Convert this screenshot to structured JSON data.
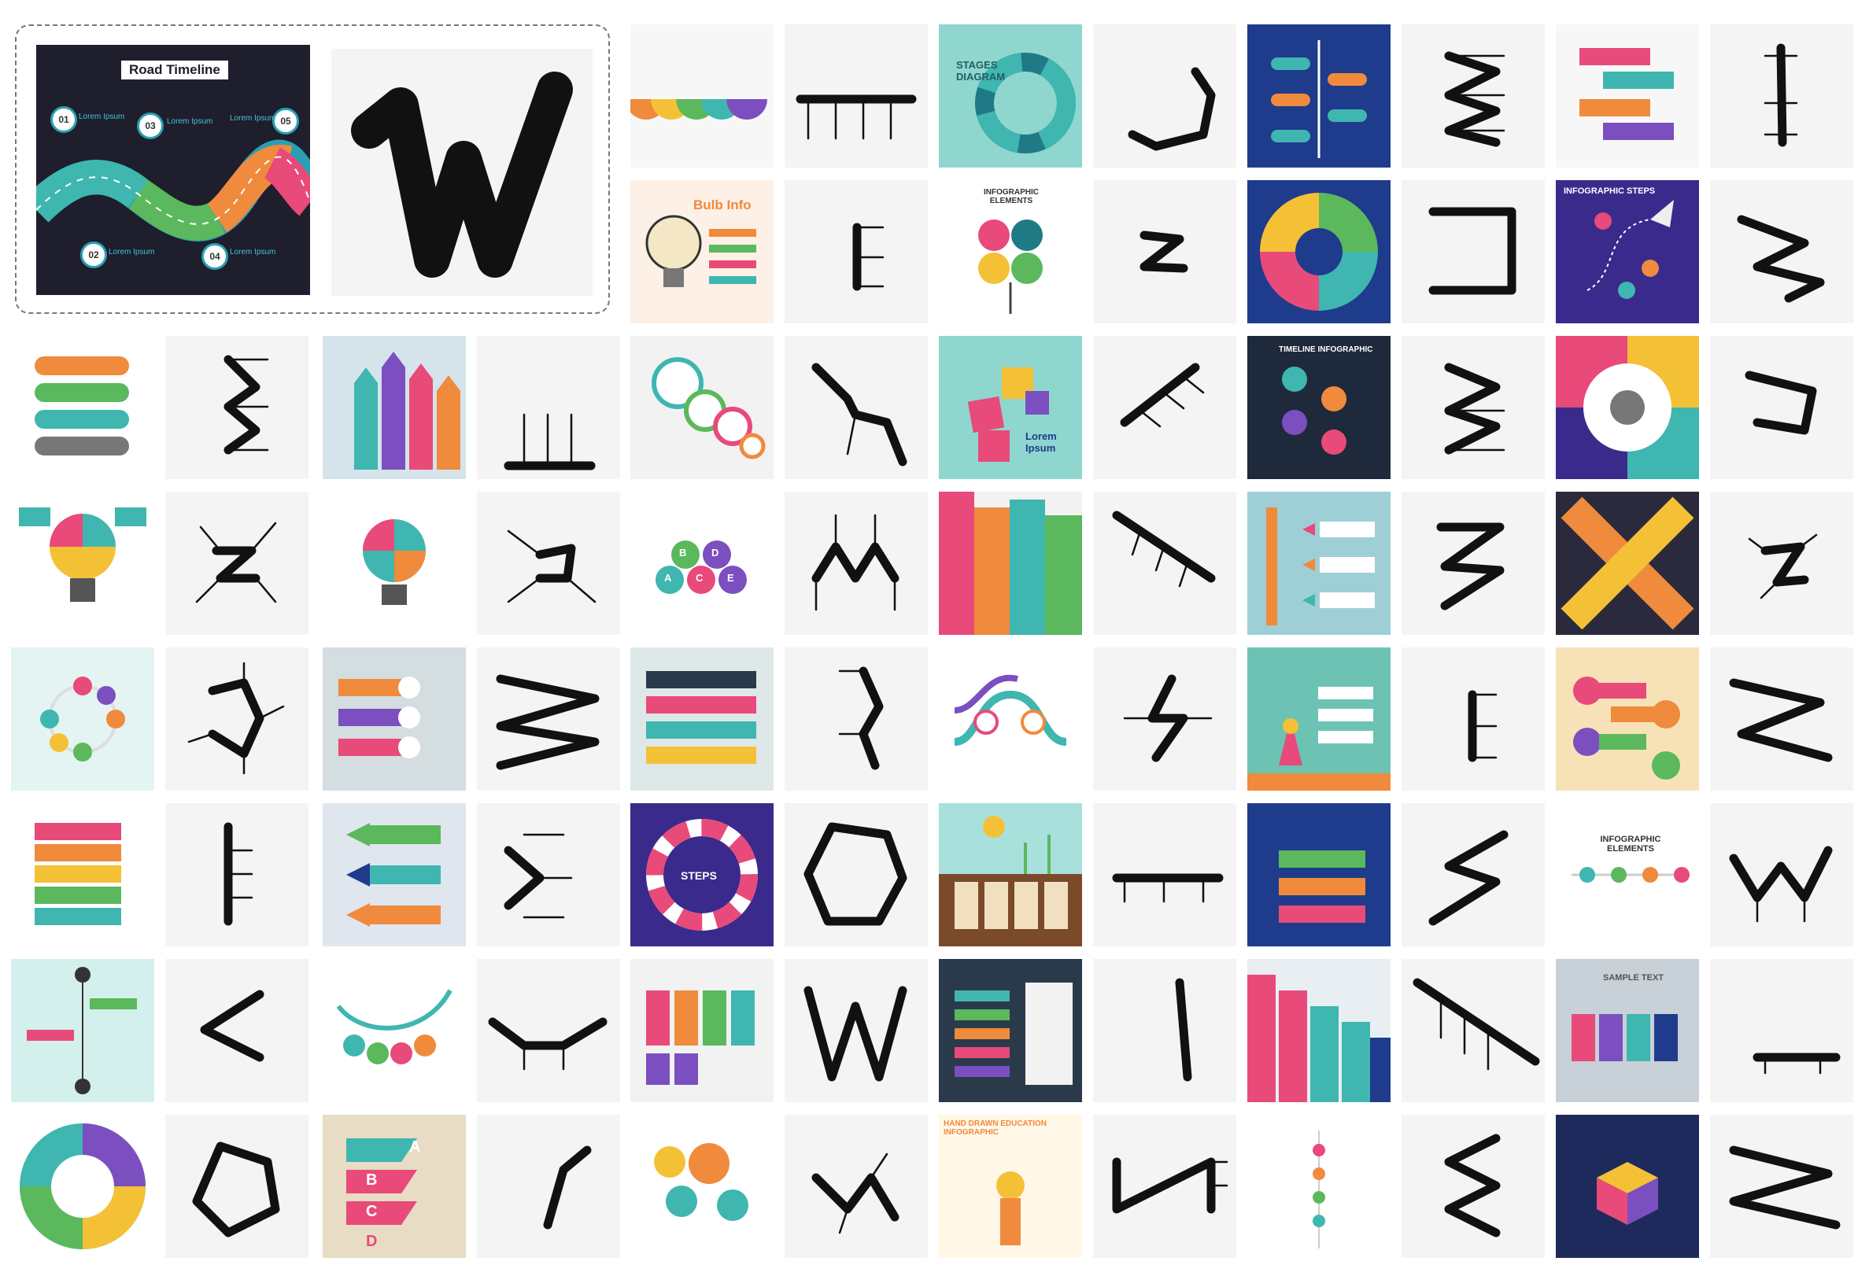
{
  "hero": {
    "title": "Road Timeline",
    "milestones": [
      "01",
      "02",
      "03",
      "04",
      "05"
    ],
    "placeholder": "Lorem Ipsum"
  },
  "thumb_texts": {
    "stages": "STAGES DIAGRAM",
    "bulb": "Bulb Info",
    "infographic_elements": "INFOGRAPHIC ELEMENTS",
    "infographic_steps": "INFOGRAPHIC STEPS",
    "timeline": "TIMELINE INFOGRAPHIC",
    "lorem": "Lorem Ipsum",
    "steps": "STEPS",
    "sample": "SAMPLE TEXT",
    "abcd": [
      "A",
      "B",
      "C",
      "D"
    ],
    "abcde": [
      "A",
      "B",
      "C",
      "D",
      "E"
    ],
    "numbers": [
      "01",
      "02",
      "03",
      "04",
      "05"
    ],
    "handdrawn": "HAND DRAWN EDUCATION INFOGRAPHIC"
  },
  "sketch_glyphs": [
    "W",
    "J",
    "E",
    "Z",
    "M",
    "N",
    "V",
    "O",
    "S",
    "L"
  ],
  "colors": {
    "background": "#ffffff",
    "sketch_bg": "#f4f4f4",
    "ink": "#111111",
    "road_bg": "#1e1e2c",
    "teal": "#2a9fb3",
    "green": "#5bb85d",
    "orange": "#f08a3c",
    "pink": "#e84a7a",
    "purple": "#7b4fbf",
    "navy": "#1f3b8c"
  }
}
